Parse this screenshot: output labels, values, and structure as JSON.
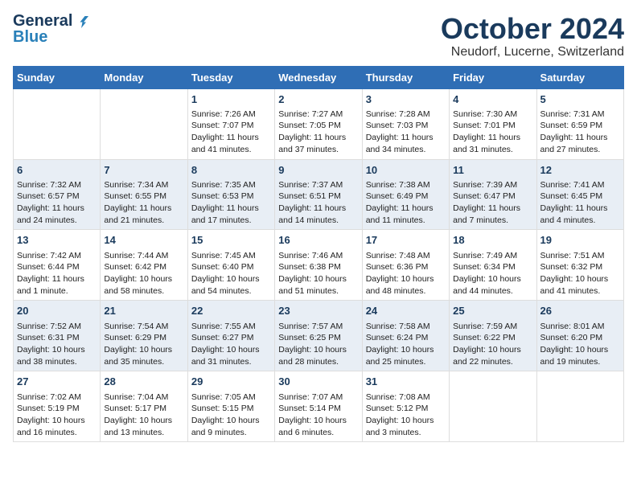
{
  "logo": {
    "general": "General",
    "blue": "Blue"
  },
  "title": "October 2024",
  "location": "Neudorf, Lucerne, Switzerland",
  "days_header": [
    "Sunday",
    "Monday",
    "Tuesday",
    "Wednesday",
    "Thursday",
    "Friday",
    "Saturday"
  ],
  "weeks": [
    [
      {
        "num": "",
        "text": ""
      },
      {
        "num": "",
        "text": ""
      },
      {
        "num": "1",
        "text": "Sunrise: 7:26 AM\nSunset: 7:07 PM\nDaylight: 11 hours and 41 minutes."
      },
      {
        "num": "2",
        "text": "Sunrise: 7:27 AM\nSunset: 7:05 PM\nDaylight: 11 hours and 37 minutes."
      },
      {
        "num": "3",
        "text": "Sunrise: 7:28 AM\nSunset: 7:03 PM\nDaylight: 11 hours and 34 minutes."
      },
      {
        "num": "4",
        "text": "Sunrise: 7:30 AM\nSunset: 7:01 PM\nDaylight: 11 hours and 31 minutes."
      },
      {
        "num": "5",
        "text": "Sunrise: 7:31 AM\nSunset: 6:59 PM\nDaylight: 11 hours and 27 minutes."
      }
    ],
    [
      {
        "num": "6",
        "text": "Sunrise: 7:32 AM\nSunset: 6:57 PM\nDaylight: 11 hours and 24 minutes."
      },
      {
        "num": "7",
        "text": "Sunrise: 7:34 AM\nSunset: 6:55 PM\nDaylight: 11 hours and 21 minutes."
      },
      {
        "num": "8",
        "text": "Sunrise: 7:35 AM\nSunset: 6:53 PM\nDaylight: 11 hours and 17 minutes."
      },
      {
        "num": "9",
        "text": "Sunrise: 7:37 AM\nSunset: 6:51 PM\nDaylight: 11 hours and 14 minutes."
      },
      {
        "num": "10",
        "text": "Sunrise: 7:38 AM\nSunset: 6:49 PM\nDaylight: 11 hours and 11 minutes."
      },
      {
        "num": "11",
        "text": "Sunrise: 7:39 AM\nSunset: 6:47 PM\nDaylight: 11 hours and 7 minutes."
      },
      {
        "num": "12",
        "text": "Sunrise: 7:41 AM\nSunset: 6:45 PM\nDaylight: 11 hours and 4 minutes."
      }
    ],
    [
      {
        "num": "13",
        "text": "Sunrise: 7:42 AM\nSunset: 6:44 PM\nDaylight: 11 hours and 1 minute."
      },
      {
        "num": "14",
        "text": "Sunrise: 7:44 AM\nSunset: 6:42 PM\nDaylight: 10 hours and 58 minutes."
      },
      {
        "num": "15",
        "text": "Sunrise: 7:45 AM\nSunset: 6:40 PM\nDaylight: 10 hours and 54 minutes."
      },
      {
        "num": "16",
        "text": "Sunrise: 7:46 AM\nSunset: 6:38 PM\nDaylight: 10 hours and 51 minutes."
      },
      {
        "num": "17",
        "text": "Sunrise: 7:48 AM\nSunset: 6:36 PM\nDaylight: 10 hours and 48 minutes."
      },
      {
        "num": "18",
        "text": "Sunrise: 7:49 AM\nSunset: 6:34 PM\nDaylight: 10 hours and 44 minutes."
      },
      {
        "num": "19",
        "text": "Sunrise: 7:51 AM\nSunset: 6:32 PM\nDaylight: 10 hours and 41 minutes."
      }
    ],
    [
      {
        "num": "20",
        "text": "Sunrise: 7:52 AM\nSunset: 6:31 PM\nDaylight: 10 hours and 38 minutes."
      },
      {
        "num": "21",
        "text": "Sunrise: 7:54 AM\nSunset: 6:29 PM\nDaylight: 10 hours and 35 minutes."
      },
      {
        "num": "22",
        "text": "Sunrise: 7:55 AM\nSunset: 6:27 PM\nDaylight: 10 hours and 31 minutes."
      },
      {
        "num": "23",
        "text": "Sunrise: 7:57 AM\nSunset: 6:25 PM\nDaylight: 10 hours and 28 minutes."
      },
      {
        "num": "24",
        "text": "Sunrise: 7:58 AM\nSunset: 6:24 PM\nDaylight: 10 hours and 25 minutes."
      },
      {
        "num": "25",
        "text": "Sunrise: 7:59 AM\nSunset: 6:22 PM\nDaylight: 10 hours and 22 minutes."
      },
      {
        "num": "26",
        "text": "Sunrise: 8:01 AM\nSunset: 6:20 PM\nDaylight: 10 hours and 19 minutes."
      }
    ],
    [
      {
        "num": "27",
        "text": "Sunrise: 7:02 AM\nSunset: 5:19 PM\nDaylight: 10 hours and 16 minutes."
      },
      {
        "num": "28",
        "text": "Sunrise: 7:04 AM\nSunset: 5:17 PM\nDaylight: 10 hours and 13 minutes."
      },
      {
        "num": "29",
        "text": "Sunrise: 7:05 AM\nSunset: 5:15 PM\nDaylight: 10 hours and 9 minutes."
      },
      {
        "num": "30",
        "text": "Sunrise: 7:07 AM\nSunset: 5:14 PM\nDaylight: 10 hours and 6 minutes."
      },
      {
        "num": "31",
        "text": "Sunrise: 7:08 AM\nSunset: 5:12 PM\nDaylight: 10 hours and 3 minutes."
      },
      {
        "num": "",
        "text": ""
      },
      {
        "num": "",
        "text": ""
      }
    ]
  ]
}
